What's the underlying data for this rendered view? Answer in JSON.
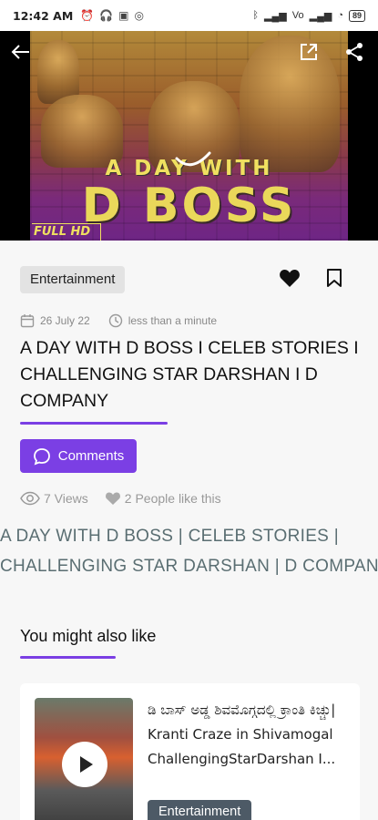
{
  "status_bar": {
    "time": "12:42 AM",
    "battery": "89"
  },
  "hero": {
    "title_line1": "A DAY WITH",
    "title_line2": "D BOSS",
    "badge": "FULL HD"
  },
  "article": {
    "category": "Entertainment",
    "date": "26 July 22",
    "read_time": "less than a minute",
    "title": "A DAY WITH D BOSS I CELEB STORIES I CHALLENGING STAR DARSHAN I D COMPANY",
    "comments_label": "Comments",
    "views": "7 Views",
    "likes": "2  People like this",
    "body_line1": "A DAY WITH D BOSS | CELEB STORIES |",
    "body_line2": "CHALLENGING STAR DARSHAN | D COMPANY"
  },
  "related": {
    "section_title": "You might also like",
    "items": [
      {
        "title": "ಡಿ ಬಾಸ್ ಅಡ್ಡ ಶಿವಮೊಗ್ಗದಲ್ಲಿ ಕ್ರಾಂತಿ ಕಿಚ್ಚು| Kranti Craze in Shivamogal ChallengingStarDarshan I...",
        "category": "Entertainment"
      }
    ]
  },
  "colors": {
    "accent": "#7b3fe4",
    "chip_dark": "#4d5a66",
    "chip_light": "#e3e3e3"
  }
}
